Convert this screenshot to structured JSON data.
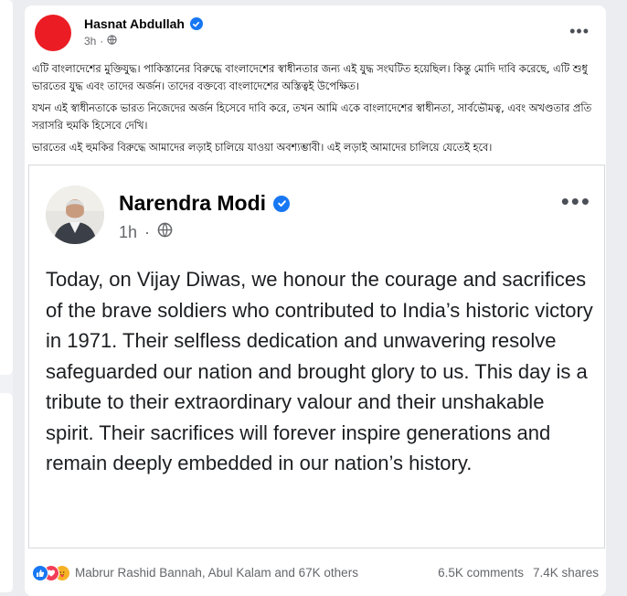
{
  "post": {
    "author": "Hasnat Abdullah",
    "time": "3h",
    "more_label": "•••",
    "paragraphs": [
      "এটি বাংলাদেশের মুক্তিযুদ্ধ। পাকিস্তানের বিরুদ্ধে বাংলাদেশের স্বাধীনতার জন্য এই যুদ্ধ সংঘটিত হয়েছিল। কিন্তু মোদি দাবি করেছে, এটি শুধু ভারতের যুদ্ধ এবং তাদের অর্জন। তাদের বক্তব্যে বাংলাদেশের অস্তিত্বই উপেক্ষিত।",
      "যখন এই স্বাধীনতাকে ভারত নিজেদের অর্জন হিসেবে দাবি করে, তখন আমি একে বাংলাদেশের স্বাধীনতা, সার্বভৌমত্ব, এবং অখণ্ডতার প্রতি সরাসরি হুমকি হিসেবে দেখি।",
      "ভারতের এই হুমকির বিরুদ্ধে আমাদের লড়াই চালিয়ে যাওয়া অবশ্যম্ভাবী। এই লড়াই আমাদের চালিয়ে যেতেই হবে।"
    ]
  },
  "shared": {
    "author": "Narendra Modi",
    "time": "1h",
    "more_label": "•••",
    "text": "Today, on Vijay Diwas, we honour the courage and sacrifices of the brave soldiers who contributed to India’s historic victory in 1971. Their selfless dedication and unwavering resolve safeguarded our nation and brought glory to us. This day is a tribute to their extraordinary valour and their unshakable spirit. Their sacrifices will forever inspire generations and remain deeply embedded in our nation’s history."
  },
  "footer": {
    "reactors": "Mabrur Rashid Bannah, Abul Kalam and 67K others",
    "comments": "6.5K comments",
    "shares": "7.4K shares",
    "reaction_icons": [
      "like-icon",
      "love-icon",
      "care-icon"
    ]
  },
  "colors": {
    "brand_blue": "#1877f2",
    "avatar_red": "#ec1c24",
    "secondary_text": "#65676b"
  }
}
